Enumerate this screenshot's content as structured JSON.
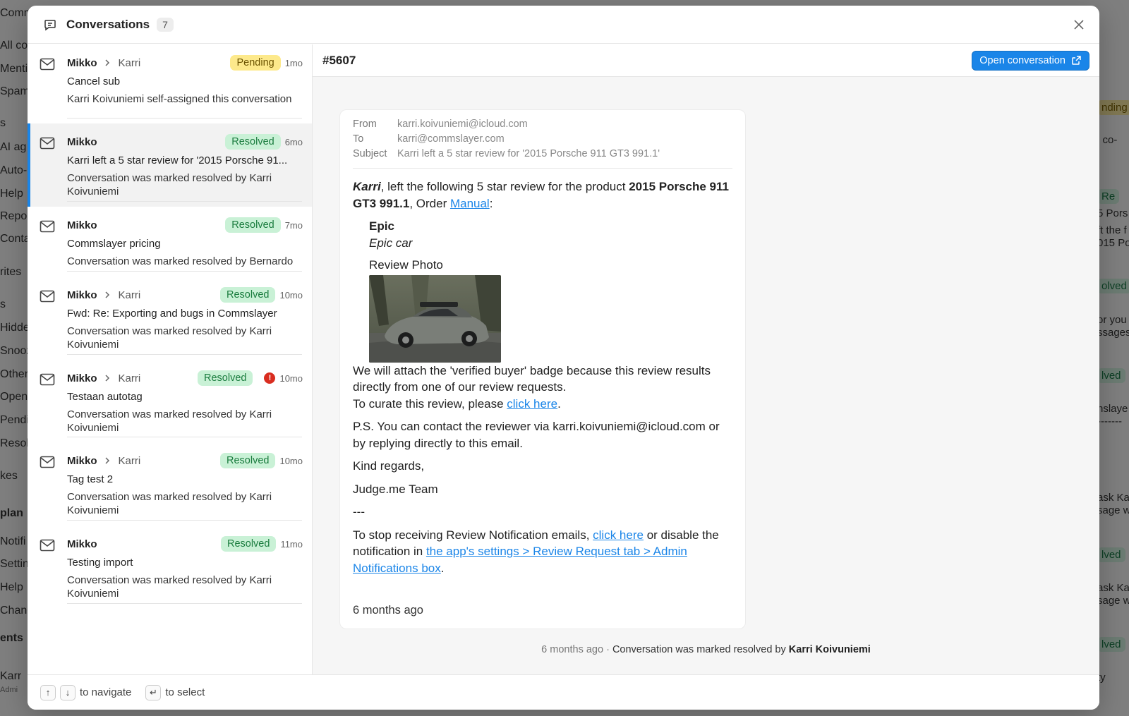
{
  "background": {
    "sidebar": [
      "Comm",
      "All co",
      "Menti",
      "Spam",
      "s",
      "AI ag",
      "Auto-",
      "Help",
      "Repor",
      "Conta",
      "rites",
      "s",
      "Hidde",
      "Snooz",
      "Other",
      "Open",
      "Pendi",
      "Resol",
      "kes",
      "plan",
      "Notifi",
      "Settin",
      "Help",
      "Chang",
      "ents",
      "Karr",
      "Admi"
    ],
    "right": [
      "nding",
      "i co-",
      "Re",
      "5 Pors",
      "ft the f",
      "015 Por",
      "olved",
      "or you",
      "ssages",
      "lved",
      "nslaye",
      "-------",
      "ask Ka",
      "sage w",
      "lved",
      "ask Ka",
      "sage w",
      "lved",
      "ty"
    ]
  },
  "modal": {
    "title": "Conversations",
    "count": "7"
  },
  "conversations": [
    {
      "from": "Mikko",
      "to": "Karri",
      "status": "Pending",
      "time": "1mo",
      "subject": "Cancel sub",
      "desc": "Karri Koivuniemi self-assigned this conversation"
    },
    {
      "from": "Mikko",
      "to": "",
      "status": "Resolved",
      "time": "6mo",
      "subject": "Karri left a 5 star review for '2015 Porsche 91...",
      "desc": "Conversation was marked resolved by Karri Koivuniemi"
    },
    {
      "from": "Mikko",
      "to": "",
      "status": "Resolved",
      "time": "7mo",
      "subject": "Commslayer pricing",
      "desc": "Conversation was marked resolved by Bernardo"
    },
    {
      "from": "Mikko",
      "to": "Karri",
      "status": "Resolved",
      "time": "10mo",
      "subject": "Fwd: Re: Exporting and bugs in Commslayer",
      "desc": "Conversation was marked resolved by Karri Koivuniemi"
    },
    {
      "from": "Mikko",
      "to": "Karri",
      "status": "Resolved",
      "time": "10mo",
      "subject": "Testaan autotag",
      "desc": "Conversation was marked resolved by Karri Koivuniemi",
      "alert": "!"
    },
    {
      "from": "Mikko",
      "to": "Karri",
      "status": "Resolved",
      "time": "10mo",
      "subject": "Tag test 2",
      "desc": "Conversation was marked resolved by Karri Koivuniemi"
    },
    {
      "from": "Mikko",
      "to": "",
      "status": "Resolved",
      "time": "11mo",
      "subject": "Testing import",
      "desc": "Conversation was marked resolved by Karri Koivuniemi"
    }
  ],
  "detail": {
    "id": "#5607",
    "open_label": "Open conversation",
    "meta": {
      "from_label": "From",
      "from": "karri.koivuniemi@icloud.com",
      "to_label": "To",
      "to": "karri@commslayer.com",
      "subject_label": "Subject",
      "subject": "Karri left a 5 star review for '2015 Porsche 911 GT3 991.1'"
    },
    "email": {
      "name": "Karri",
      "intro": ", left the following 5 star review for the product ",
      "product": "2015 Porsche 911 GT3 991.1",
      "order_text": ", Order ",
      "order_link": "Manual",
      "colon": ":",
      "review_title": "Epic",
      "review_body": "Epic car",
      "photo_label": "Review Photo",
      "badge_text": "We will attach the 'verified buyer' badge because this review results directly from one of our review requests.",
      "curate_text": "To curate this review, please ",
      "curate_link": "click here",
      "period": ".",
      "ps": "P.S. You can contact the reviewer via karri.koivuniemi@icloud.com or by replying directly to this email.",
      "regards": "Kind regards,",
      "team": "Judge.me Team",
      "divider": "---",
      "stop_text": "To stop receiving Review Notification emails, ",
      "stop_link": "click here",
      "disable_text": " or disable the notification in ",
      "settings_link": "the app's settings > Review Request tab > Admin Notifications box",
      "period2": "."
    },
    "card_time": "6 months ago",
    "activity": {
      "time": "6 months ago",
      "dot": " · ",
      "text": "Conversation was marked resolved by ",
      "user": "Karri Koivuniemi"
    }
  },
  "footer": {
    "up_key": "↑",
    "down_key": "↓",
    "navigate": "to navigate",
    "enter_key": "↵",
    "select": "to select"
  },
  "colors": {
    "accent": "#1a85e8",
    "resolved_bg": "#c9f1d6",
    "pending_bg": "#fde98b",
    "alert": "#d92d20"
  }
}
